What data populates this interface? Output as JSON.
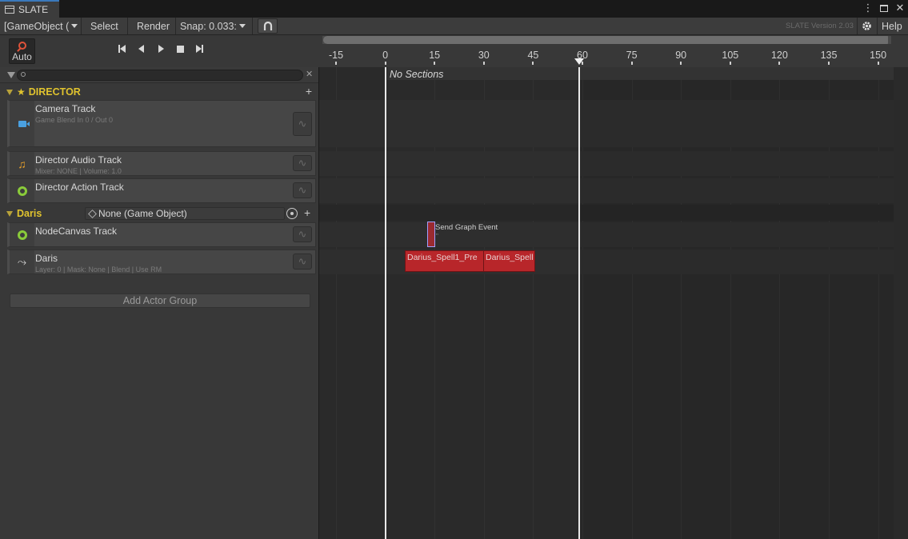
{
  "window": {
    "tab_title": "SLATE"
  },
  "toolbar": {
    "target_dropdown": "[GameObject (",
    "select_label": "Select",
    "render_label": "Render",
    "snap_label": "Snap: 0.033:",
    "version_text": "SLATE Version 2.03",
    "help_label": "Help"
  },
  "playback": {
    "auto_label": "Auto"
  },
  "ruler": {
    "ticks": [
      "-15",
      "0",
      "15",
      "30",
      "45",
      "60",
      "75",
      "90",
      "105",
      "120",
      "135",
      "150"
    ]
  },
  "groups": {
    "director": {
      "name": "DIRECTOR",
      "tracks": [
        {
          "name": "Camera Track",
          "sub": "Game Blend In 0 / Out 0",
          "icon": "camera-icon"
        },
        {
          "name": "Director Audio Track",
          "sub": "Mixer: NONE | Volume: 1.0",
          "icon": "music-note-icon"
        },
        {
          "name": "Director Action Track",
          "sub": "",
          "icon": "ring-icon"
        }
      ]
    },
    "actor": {
      "name": "Daris",
      "actor_field": "None (Game Object)",
      "tracks": [
        {
          "name": "NodeCanvas Track",
          "sub": "",
          "icon": "ring-icon"
        },
        {
          "name": "Daris",
          "sub": "Layer: 0 | Mask: None | Blend | Use RM",
          "icon": "animation-icon"
        }
      ]
    }
  },
  "add_actor_label": "Add Actor Group",
  "timeline": {
    "sections_text": "No Sections",
    "event_clip_label": "Send Graph Event",
    "event_clip_sub": "\"",
    "anim_clips": [
      "Darius_Spell1_Pre",
      "Darius_Spell"
    ]
  },
  "colors": {
    "accent_gold": "#e0c32e",
    "clip_red": "#b8262a",
    "camera_blue": "#4aa0e0",
    "action_green": "#8acb3a",
    "audio_orange": "#e8a02a"
  }
}
